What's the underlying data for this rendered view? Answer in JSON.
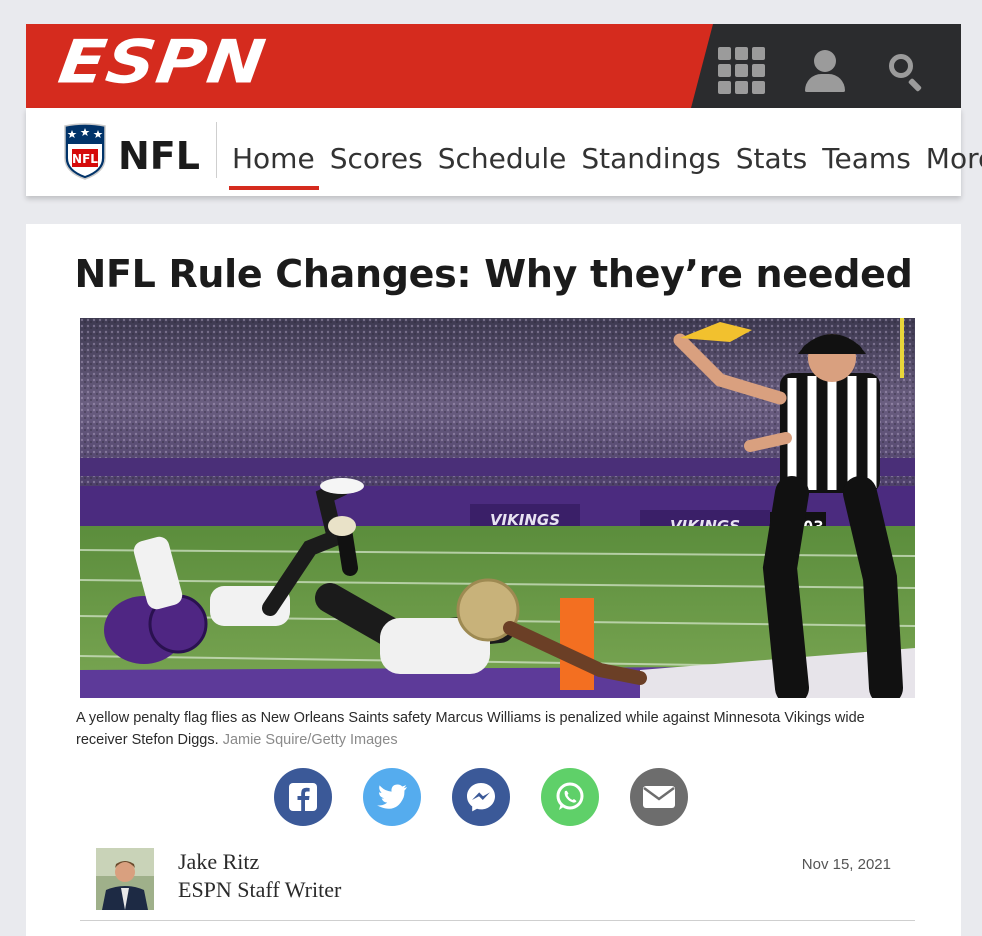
{
  "brand": {
    "logo_text": "ESPN",
    "accent": "#d52b1e",
    "dark": "#2b2c2e"
  },
  "top_icons": [
    "apps-grid-icon",
    "user-icon",
    "search-icon"
  ],
  "nav": {
    "section_logo": "NFL",
    "section_title": "NFL",
    "items": [
      {
        "label": "Home",
        "active": true
      },
      {
        "label": "Scores"
      },
      {
        "label": "Schedule"
      },
      {
        "label": "Standings"
      },
      {
        "label": "Stats"
      },
      {
        "label": "Teams"
      },
      {
        "label": "More"
      }
    ]
  },
  "article": {
    "headline": "NFL Rule Changes: Why they’re needed",
    "image": {
      "scoreboard_text": "10:03",
      "banner_text_1": "VIKINGS",
      "banner_text_2": "VIKINGS"
    },
    "caption": "A yellow penalty flag flies as New Orleans Saints safety Marcus Williams is penalized while against Minnesota Vikings wide receiver Stefon Diggs.",
    "credit": "Jamie Squire/Getty Images",
    "share": [
      {
        "name": "facebook-share-button",
        "icon": "facebook-icon",
        "color": "#3b5998"
      },
      {
        "name": "twitter-share-button",
        "icon": "twitter-icon",
        "color": "#55acee"
      },
      {
        "name": "messenger-share-button",
        "icon": "messenger-icon",
        "color": "#3b5998"
      },
      {
        "name": "whatsapp-share-button",
        "icon": "whatsapp-icon",
        "color": "#5fd069"
      },
      {
        "name": "email-share-button",
        "icon": "email-icon",
        "color": "#6d6d6d"
      }
    ],
    "author": {
      "name": "Jake Ritz",
      "role": "ESPN Staff Writer"
    },
    "date": "Nov 15, 2021"
  }
}
